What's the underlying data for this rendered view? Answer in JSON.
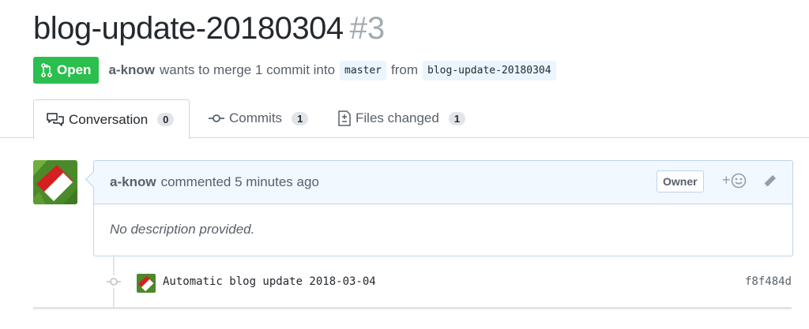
{
  "pr": {
    "title": "blog-update-20180304",
    "number": "#3",
    "state": "Open",
    "author": "a-know",
    "summary_text": "wants to merge 1 commit into",
    "base_branch": "master",
    "from_text": "from",
    "head_branch": "blog-update-20180304"
  },
  "tabs": [
    {
      "label": "Conversation",
      "count": "0",
      "icon": "comment-discussion-icon"
    },
    {
      "label": "Commits",
      "count": "1",
      "icon": "git-commit-icon"
    },
    {
      "label": "Files changed",
      "count": "1",
      "icon": "file-diff-icon"
    }
  ],
  "comment": {
    "author": "a-know",
    "action_text": "commented 5 minutes ago",
    "role_label": "Owner",
    "reaction_prefix": "+",
    "body": "No description provided."
  },
  "commit": {
    "message": "Automatic blog update 2018-03-04",
    "sha": "f8f484d"
  },
  "colors": {
    "open_green": "#2cbe4e",
    "link_blue": "#0366d6",
    "comment_header_bg": "#f1f8ff"
  }
}
